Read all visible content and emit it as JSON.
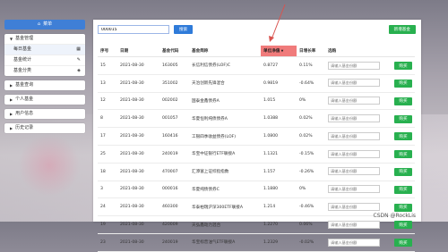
{
  "sidebar": {
    "header": "菜单",
    "groups": [
      {
        "title": "基金管理",
        "expanded": true,
        "items": [
          {
            "label": "每日基金",
            "icon": "calendar-icon",
            "active": true
          },
          {
            "label": "基金统计",
            "icon": "edit-icon",
            "active": false
          },
          {
            "label": "基金分类",
            "icon": "tag-icon",
            "active": false
          }
        ]
      },
      {
        "title": "基金查询",
        "expanded": false
      },
      {
        "title": "个人基金",
        "expanded": false
      },
      {
        "title": "用户信息",
        "expanded": false
      },
      {
        "title": "历史记录",
        "expanded": false
      }
    ]
  },
  "toolbar": {
    "search_value": "000015",
    "search_label": "搜索",
    "add_label": "新增基金"
  },
  "table": {
    "headers": [
      "序号",
      "日期",
      "基金代码",
      "基金简称",
      "单位净值",
      "日增长率",
      "选购"
    ],
    "sorted_column": 4,
    "buy_placeholder": "请输入基金份额",
    "buy_label": "购买",
    "rows": [
      [
        "15",
        "2021-08-30",
        "163005",
        "长信利信债券(LOF)C",
        "0.8727",
        "0.11%"
      ],
      [
        "13",
        "2021-08-30",
        "351002",
        "天治创新先锋混合",
        "0.9819",
        "-0.64%"
      ],
      [
        "12",
        "2021-08-30",
        "002002",
        "国泰金鑫债券A",
        "1.015",
        "0%"
      ],
      [
        "8",
        "2021-08-30",
        "001057",
        "华夏恒利纯债债券A",
        "1.0388",
        "0.02%"
      ],
      [
        "17",
        "2021-08-30",
        "160416",
        "工银四季收益债券(LOF)",
        "1.0800",
        "0.02%"
      ],
      [
        "25",
        "2021-08-30",
        "240019",
        "华宝中证银行ETF联接A",
        "1.1321",
        "-0.15%"
      ],
      [
        "18",
        "2021-08-30",
        "470007",
        "汇添富上证综指指数",
        "1.157",
        "-0.26%"
      ],
      [
        "3",
        "2021-08-30",
        "000016",
        "华夏纯债债券C",
        "1.1880",
        "0%"
      ],
      [
        "24",
        "2021-08-30",
        "460300",
        "华泰柏瑞沪深300ETF联接A",
        "1.214",
        "-0.46%"
      ],
      [
        "19",
        "2021-08-30",
        "420009",
        "天弘鑫动力混合",
        "1.2270",
        "0.06%"
      ],
      [
        "23",
        "2021-08-30",
        "240019",
        "华宝标普油气ETF联接A",
        "1.2329",
        "-0.02%"
      ]
    ]
  },
  "watermark": "CSDN @RockLis",
  "colors": {
    "primary": "#2f7bd9",
    "success": "#28b04f",
    "sorted_header": "#f07b7b",
    "annotation_arrow": "#d9534f"
  }
}
